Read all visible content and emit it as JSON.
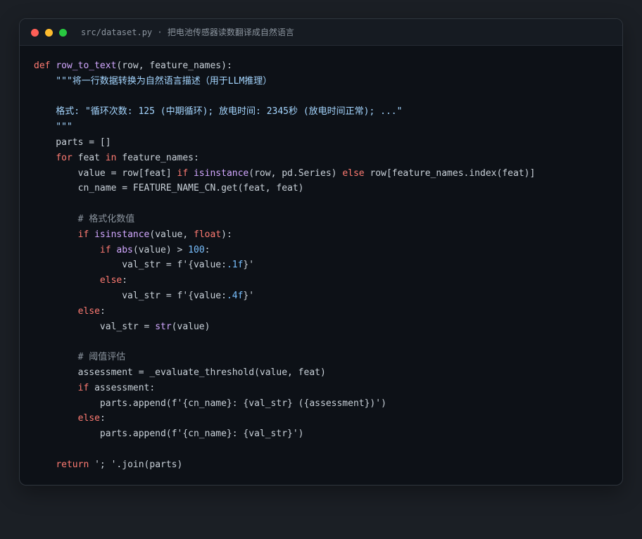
{
  "window": {
    "title": "src/dataset.py · 把电池传感器读数翻译成自然语言"
  },
  "code": {
    "lines": [
      [
        {
          "t": "def",
          "c": "kw"
        },
        {
          "t": " ",
          "c": "id"
        },
        {
          "t": "row_to_text",
          "c": "fn"
        },
        {
          "t": "(row, feature_names):",
          "c": "id"
        }
      ],
      [
        {
          "t": "    \"\"\"将一行数据转换为自然语言描述（用于LLM推理）",
          "c": "str"
        }
      ],
      [],
      [
        {
          "t": "    格式: \"循环次数: 125 (中期循环); 放电时间: 2345秒 (放电时间正常); ...\"",
          "c": "str"
        }
      ],
      [
        {
          "t": "    \"\"\"",
          "c": "str"
        }
      ],
      [
        {
          "t": "    parts = []",
          "c": "id"
        }
      ],
      [
        {
          "t": "    ",
          "c": "id"
        },
        {
          "t": "for",
          "c": "kw"
        },
        {
          "t": " feat ",
          "c": "id"
        },
        {
          "t": "in",
          "c": "kw"
        },
        {
          "t": " feature_names:",
          "c": "id"
        }
      ],
      [
        {
          "t": "        value = row[feat] ",
          "c": "id"
        },
        {
          "t": "if",
          "c": "kw"
        },
        {
          "t": " ",
          "c": "id"
        },
        {
          "t": "isinstance",
          "c": "bi"
        },
        {
          "t": "(row, pd.Series) ",
          "c": "id"
        },
        {
          "t": "else",
          "c": "kw"
        },
        {
          "t": " row[feature_names.index(feat)]",
          "c": "id"
        }
      ],
      [
        {
          "t": "        cn_name = FEATURE_NAME_CN.get(feat, feat)",
          "c": "id"
        }
      ],
      [],
      [
        {
          "t": "        # 格式化数值",
          "c": "cm"
        }
      ],
      [
        {
          "t": "        ",
          "c": "id"
        },
        {
          "t": "if",
          "c": "kw"
        },
        {
          "t": " ",
          "c": "id"
        },
        {
          "t": "isinstance",
          "c": "bi"
        },
        {
          "t": "(value, ",
          "c": "id"
        },
        {
          "t": "float",
          "c": "kw"
        },
        {
          "t": "):",
          "c": "id"
        }
      ],
      [
        {
          "t": "            ",
          "c": "id"
        },
        {
          "t": "if",
          "c": "kw"
        },
        {
          "t": " ",
          "c": "id"
        },
        {
          "t": "abs",
          "c": "bi"
        },
        {
          "t": "(value) > ",
          "c": "id"
        },
        {
          "t": "100",
          "c": "num"
        },
        {
          "t": ":",
          "c": "id"
        }
      ],
      [
        {
          "t": "                val_str = f'{value:",
          "c": "id"
        },
        {
          "t": ".1f",
          "c": "num"
        },
        {
          "t": "}'",
          "c": "id"
        }
      ],
      [
        {
          "t": "            ",
          "c": "id"
        },
        {
          "t": "else",
          "c": "kw"
        },
        {
          "t": ":",
          "c": "id"
        }
      ],
      [
        {
          "t": "                val_str = f'{value:",
          "c": "id"
        },
        {
          "t": ".4f",
          "c": "num"
        },
        {
          "t": "}'",
          "c": "id"
        }
      ],
      [
        {
          "t": "        ",
          "c": "id"
        },
        {
          "t": "else",
          "c": "kw"
        },
        {
          "t": ":",
          "c": "id"
        }
      ],
      [
        {
          "t": "            val_str = ",
          "c": "id"
        },
        {
          "t": "str",
          "c": "bi"
        },
        {
          "t": "(value)",
          "c": "id"
        }
      ],
      [],
      [
        {
          "t": "        # 阈值评估",
          "c": "cm"
        }
      ],
      [
        {
          "t": "        assessment = _evaluate_threshold(value, feat)",
          "c": "id"
        }
      ],
      [
        {
          "t": "        ",
          "c": "id"
        },
        {
          "t": "if",
          "c": "kw"
        },
        {
          "t": " assessment:",
          "c": "id"
        }
      ],
      [
        {
          "t": "            parts.append(f'{cn_name}: {val_str} ({assessment})')",
          "c": "id"
        }
      ],
      [
        {
          "t": "        ",
          "c": "id"
        },
        {
          "t": "else",
          "c": "kw"
        },
        {
          "t": ":",
          "c": "id"
        }
      ],
      [
        {
          "t": "            parts.append(f'{cn_name}: {val_str}')",
          "c": "id"
        }
      ],
      [],
      [
        {
          "t": "    ",
          "c": "id"
        },
        {
          "t": "return",
          "c": "kw"
        },
        {
          "t": " '; '.join(parts)",
          "c": "id"
        }
      ]
    ]
  }
}
